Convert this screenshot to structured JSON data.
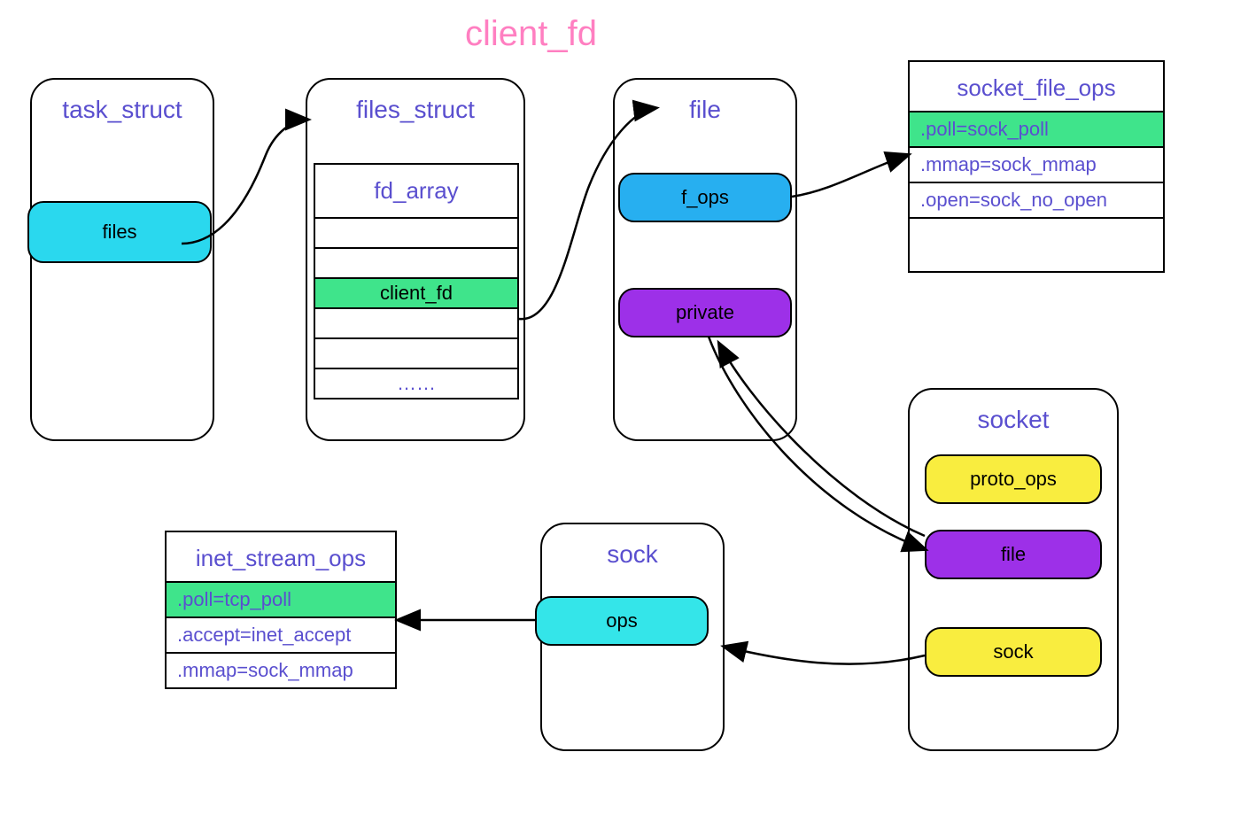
{
  "title": "client_fd",
  "colors": {
    "title": "#ff7fc1",
    "label": "#5a4fcf",
    "cyan": "#2ad8ee",
    "cyan2": "#34e5e9",
    "blue": "#27aff0",
    "purple": "#9d30e8",
    "green": "#3fe48b",
    "yellow": "#f9ed3f"
  },
  "task_struct": {
    "title": "task_struct",
    "member": "files"
  },
  "files_struct": {
    "title": "files_struct",
    "array_label": "fd_array",
    "rows": [
      "",
      "",
      "client_fd",
      "",
      "",
      "……"
    ]
  },
  "file": {
    "title": "file",
    "f_ops": "f_ops",
    "private": "private"
  },
  "socket_file_ops": {
    "title": "socket_file_ops",
    "rows": [
      {
        "text": ".poll=sock_poll",
        "highlight": true
      },
      {
        "text": ".mmap=sock_mmap",
        "highlight": false
      },
      {
        "text": ".open=sock_no_open",
        "highlight": false
      }
    ]
  },
  "socket": {
    "title": "socket",
    "proto_ops": "proto_ops",
    "file": "file",
    "sock": "sock"
  },
  "sock_box": {
    "title": "sock",
    "ops": "ops"
  },
  "inet_stream_ops": {
    "title": "inet_stream_ops",
    "rows": [
      {
        "text": ".poll=tcp_poll",
        "highlight": true
      },
      {
        "text": ".accept=inet_accept",
        "highlight": false
      },
      {
        "text": ".mmap=sock_mmap",
        "highlight": false
      }
    ]
  }
}
